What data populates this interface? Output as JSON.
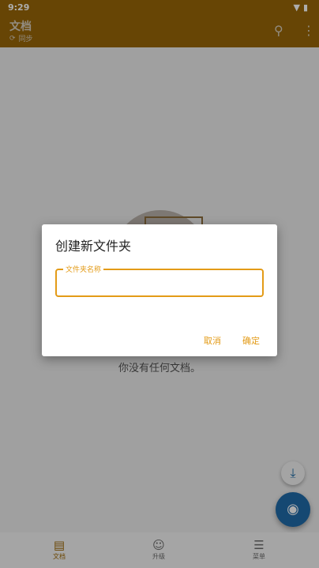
{
  "status_bar": {
    "time": "9:29",
    "icons": [
      "wifi-icon",
      "battery-icon"
    ]
  },
  "app_bar": {
    "title": "文档",
    "sync_label": "同步",
    "icons": [
      "sync-icon",
      "search-icon",
      "more-vert-icon"
    ]
  },
  "empty_state": {
    "message": "你没有任何文档。"
  },
  "dialog": {
    "title": "创建新文件夹",
    "field_label": "文件夹名称",
    "field_value": "",
    "cancel_label": "取消",
    "confirm_label": "确定"
  },
  "fabs": {
    "download_icon": "download-icon",
    "camera_icon": "camera-icon"
  },
  "bottom_nav": {
    "items": [
      {
        "label": "文档",
        "icon": "documents-icon",
        "active": true
      },
      {
        "label": "升级",
        "icon": "smile-icon",
        "active": false
      },
      {
        "label": "菜单",
        "icon": "menu-icon",
        "active": false
      }
    ]
  },
  "colors": {
    "app_bar": "#986608",
    "accent": "#e39b17",
    "fab": "#1f6aa8"
  }
}
